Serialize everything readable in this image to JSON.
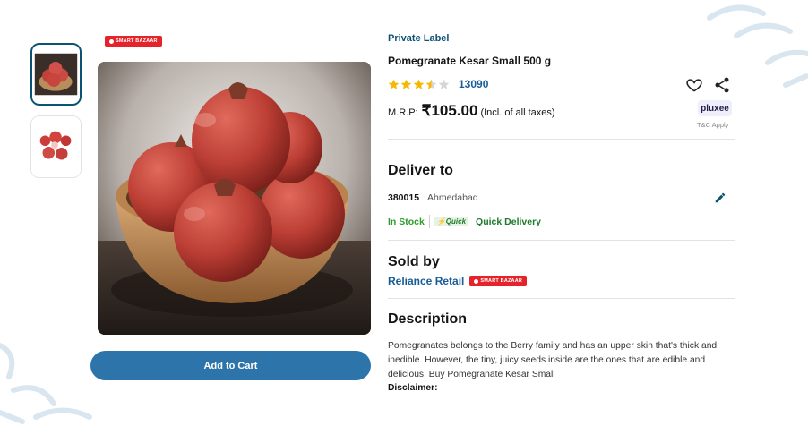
{
  "badge": {
    "label": "SMART BAZAAR"
  },
  "product": {
    "brand": "Private Label",
    "title": "Pomegranate Kesar Small 500 g",
    "rating": 3.5,
    "rating_count": "13090"
  },
  "price": {
    "label": "M.R.P:",
    "value": "₹105.00",
    "tax_note": "(Incl. of all taxes)"
  },
  "pluxee": {
    "label": "pluxee",
    "terms": "T&C Apply"
  },
  "delivery": {
    "heading": "Deliver to",
    "pincode": "380015",
    "city": "Ahmedabad",
    "stock": "In Stock",
    "quick_logo": "⚡Quick",
    "quick_label": "Quick Delivery"
  },
  "seller": {
    "heading": "Sold by",
    "name": "Reliance Retail"
  },
  "description": {
    "heading": "Description",
    "text": "Pomegranates belongs to the Berry family and has an upper skin that's thick and inedible. However, the tiny, juicy seeds inside are the ones that are edible and delicious. Buy Pomegranate Kesar Small",
    "disclaimer": "Disclaimer:"
  },
  "cart": {
    "label": "Add to Cart"
  },
  "colors": {
    "accent": "#2c74aa",
    "brand_blue": "#0c5273",
    "stock_green": "#2e9b31",
    "badge_red": "#e5232a",
    "star_gold": "#f5b800"
  },
  "icons": [
    "heart-icon",
    "share-icon",
    "pencil-icon",
    "star-icon"
  ]
}
